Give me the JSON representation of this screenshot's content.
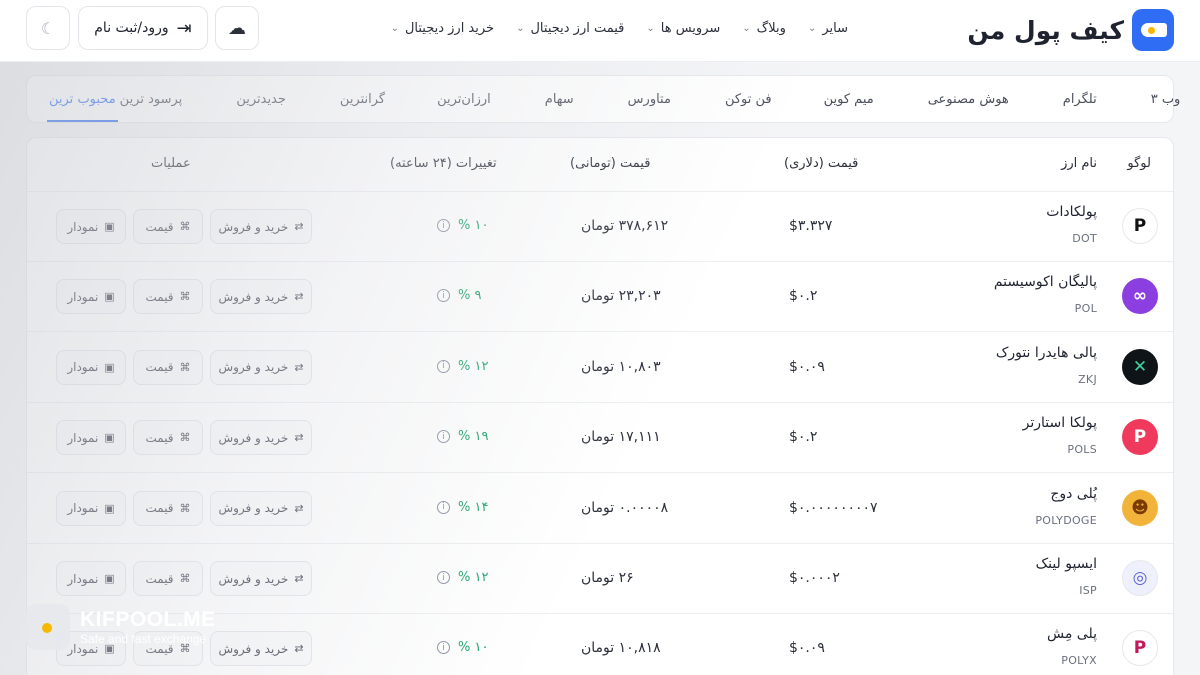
{
  "header": {
    "logo_text": "کیف پول من",
    "nav": [
      {
        "label": "خرید ارز دیجیتال"
      },
      {
        "label": "قیمت ارز دیجیتال"
      },
      {
        "label": "سرویس ها"
      },
      {
        "label": "وبلاگ"
      },
      {
        "label": "سایر"
      }
    ],
    "login_label": "ورود/ثبت نام"
  },
  "tabs": [
    {
      "label": "محبوب ترین",
      "active": true
    },
    {
      "label": "پرسود ترین"
    },
    {
      "label": "جدیدترین"
    },
    {
      "label": "گرانترین"
    },
    {
      "label": "ارزان‌ترین"
    },
    {
      "label": "سهام"
    },
    {
      "label": "متاورس"
    },
    {
      "label": "فن توکن"
    },
    {
      "label": "میم کوین"
    },
    {
      "label": "هوش مصنوعی"
    },
    {
      "label": "تلگرام"
    },
    {
      "label": "وب ۳"
    }
  ],
  "table": {
    "headers": {
      "logo": "لوگو",
      "name": "نام ارز",
      "usd": "قیمت (دلاری)",
      "irr": "قیمت (تومانی)",
      "change": "تغییرات (۲۴ ساعته)",
      "actions": "عملیات"
    },
    "actions": {
      "trade": "خرید و فروش",
      "price": "قیمت",
      "chart": "نمودار"
    },
    "rows": [
      {
        "name": "پولکادات",
        "symbol": "DOT",
        "usd": "$۳.۳۲۷",
        "irr": "۳۷۸,۶۱۲ تومان",
        "change": "% ۱۰",
        "logo_color": "#ffffff",
        "logo_fg": "#111111",
        "logo_glyph": "P"
      },
      {
        "name": "پالیگان اکوسیستم",
        "symbol": "POL",
        "usd": "$۰.۲",
        "irr": "۲۳,۲۰۳ تومان",
        "change": "% ۹",
        "logo_color": "#8c3fe0",
        "logo_fg": "#ffffff",
        "logo_glyph": "∞"
      },
      {
        "name": "پالی هایدرا نتورک",
        "symbol": "ZKJ",
        "usd": "$۰.۰۹",
        "irr": "۱۰,۸۰۳ تومان",
        "change": "% ۱۲",
        "logo_color": "#0f1419",
        "logo_fg": "#3ed3a0",
        "logo_glyph": "✕"
      },
      {
        "name": "پولکا استارتر",
        "symbol": "POLS",
        "usd": "$۰.۲",
        "irr": "۱۷,۱۱۱ تومان",
        "change": "% ۱۹",
        "logo_color": "#ef3a5d",
        "logo_fg": "#ffffff",
        "logo_glyph": "P"
      },
      {
        "name": "پُلی دوج",
        "symbol": "POLYDOGE",
        "usd": "$۰.۰۰۰۰۰۰۰۰۷",
        "irr": "۰.۰۰۰۰۸ تومان",
        "change": "% ۱۴",
        "logo_color": "#f2b33a",
        "logo_fg": "#7a3a00",
        "logo_glyph": "☻"
      },
      {
        "name": "ایسپو لینک",
        "symbol": "ISP",
        "usd": "$۰.۰۰۰۲",
        "irr": "۲۶ تومان",
        "change": "% ۱۲",
        "logo_color": "#eef0fb",
        "logo_fg": "#5a63d8",
        "logo_glyph": "◎"
      },
      {
        "name": "پلی مِش",
        "symbol": "POLYX",
        "usd": "$۰.۰۹",
        "irr": "۱۰,۸۱۸ تومان",
        "change": "% ۱۰",
        "logo_color": "#ffffff",
        "logo_fg": "#c2185b",
        "logo_glyph": "P"
      }
    ]
  },
  "watermark": {
    "title": "KIFPOOL.ME",
    "subtitle": "Safe and fast exchange"
  }
}
